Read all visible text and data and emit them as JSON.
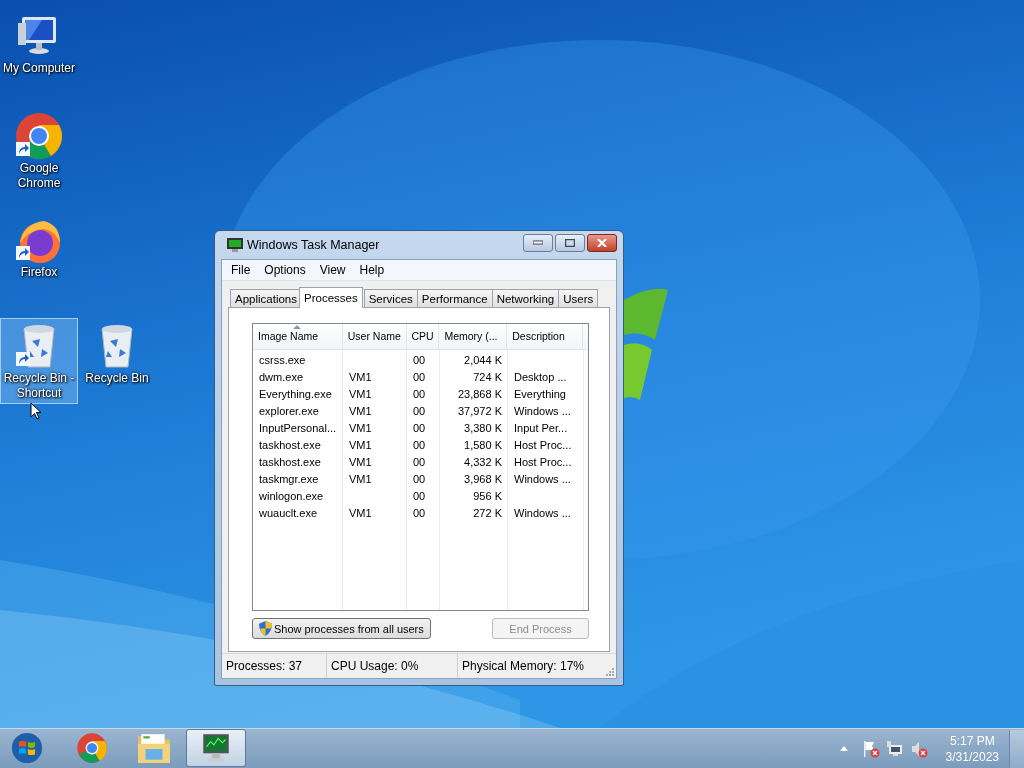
{
  "desktop_icons": [
    {
      "kind": "computer",
      "label": "My Computer",
      "shortcut": false,
      "selected": false
    },
    {
      "kind": "chrome",
      "label": "Google Chrome",
      "shortcut": true,
      "selected": false
    },
    {
      "kind": "firefox",
      "label": "Firefox",
      "shortcut": true,
      "selected": false
    },
    {
      "kind": "recycle",
      "label": "Recycle Bin - Shortcut",
      "shortcut": true,
      "selected": true
    },
    {
      "kind": "recycle",
      "label": "Recycle Bin",
      "shortcut": false,
      "selected": false
    }
  ],
  "window": {
    "title": "Windows Task Manager",
    "menu": [
      "File",
      "Options",
      "View",
      "Help"
    ],
    "tabs": [
      {
        "label": "Applications",
        "selected": false
      },
      {
        "label": "Processes",
        "selected": true
      },
      {
        "label": "Services",
        "selected": false
      },
      {
        "label": "Performance",
        "selected": false
      },
      {
        "label": "Networking",
        "selected": false
      },
      {
        "label": "Users",
        "selected": false
      }
    ],
    "table": {
      "columns": [
        {
          "label": "Image Name",
          "sorted": true
        },
        {
          "label": "User Name",
          "sorted": false
        },
        {
          "label": "CPU",
          "sorted": false
        },
        {
          "label": "Memory (...",
          "sorted": false
        },
        {
          "label": "Description",
          "sorted": false
        }
      ],
      "rows": [
        [
          "csrss.exe",
          "",
          "00",
          "2,044 K",
          ""
        ],
        [
          "dwm.exe",
          "VM1",
          "00",
          "724 K",
          "Desktop ..."
        ],
        [
          "Everything.exe",
          "VM1",
          "00",
          "23,868 K",
          "Everything"
        ],
        [
          "explorer.exe",
          "VM1",
          "00",
          "37,972 K",
          "Windows ..."
        ],
        [
          "InputPersonal...",
          "VM1",
          "00",
          "3,380 K",
          "Input Per..."
        ],
        [
          "taskhost.exe",
          "VM1",
          "00",
          "1,580 K",
          "Host Proc..."
        ],
        [
          "taskhost.exe",
          "VM1",
          "00",
          "4,332 K",
          "Host Proc..."
        ],
        [
          "taskmgr.exe",
          "VM1",
          "00",
          "3,968 K",
          "Windows ..."
        ],
        [
          "winlogon.exe",
          "",
          "00",
          "956 K",
          ""
        ],
        [
          "wuauclt.exe",
          "VM1",
          "00",
          "272 K",
          "Windows ..."
        ]
      ]
    },
    "buttons": [
      {
        "label": "Show processes from all users",
        "shield": true,
        "disabled": false
      },
      {
        "label": "End Process",
        "shield": false,
        "disabled": true
      }
    ],
    "status_bar": [
      "Processes: 37",
      "CPU Usage: 0%",
      "Physical Memory: 17%"
    ]
  },
  "taskbar": {
    "items": [
      {
        "kind": "start",
        "active": false
      },
      {
        "kind": "chrome",
        "active": false
      },
      {
        "kind": "explorer",
        "active": false
      },
      {
        "kind": "taskmgr",
        "active": true
      }
    ],
    "tray": [
      {
        "kind": "flag"
      },
      {
        "kind": "network"
      },
      {
        "kind": "speaker"
      }
    ],
    "time": "5:17 PM",
    "date": "3/31/2023"
  }
}
